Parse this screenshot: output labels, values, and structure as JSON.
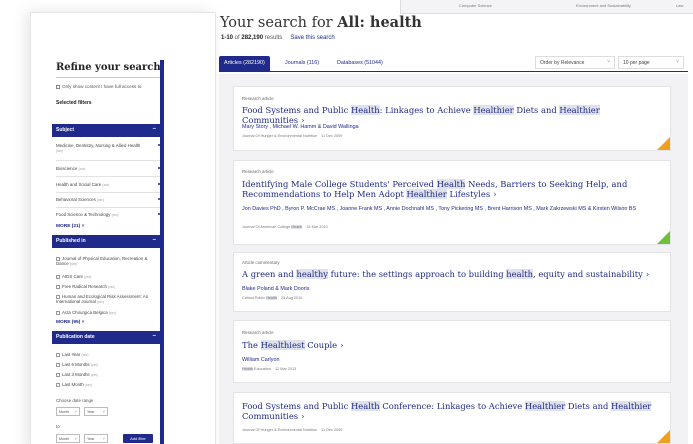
{
  "background_window": {
    "col1": "Computer Science",
    "col2": "Environment and Sustainability",
    "col3": "Law"
  },
  "search": {
    "heading_prefix": "Your search for ",
    "heading_query": "All: health",
    "range": "1-10",
    "range_of": " of ",
    "total": "282,190",
    "results_word": " results",
    "save_label": "Save this search"
  },
  "tabs": [
    {
      "label": "Articles (282190)",
      "active": true
    },
    {
      "label": "Journals (116)",
      "active": false
    },
    {
      "label": "Databases (51044)",
      "active": false
    }
  ],
  "sort": {
    "selected": "Order by Relevance"
  },
  "per_page": {
    "selected": "10 per page"
  },
  "sidebar": {
    "title": "Refine your search",
    "fulltext": "Only show content I have full access to",
    "selected_filters": "Selected filters",
    "subject": {
      "label": "Subject",
      "items": [
        {
          "label": "Medicine, Dentistry, Nursing & Allied Health",
          "count": "(xxx)"
        },
        {
          "label": "Bioscience",
          "count": "(xxx)"
        },
        {
          "label": "Health and Social Care",
          "count": "(xxx)"
        },
        {
          "label": "Behavioral Sciences",
          "count": "(xxx)"
        },
        {
          "label": "Food Science & Technology",
          "count": "(xxx)"
        }
      ],
      "more": "MORE (21) ˅"
    },
    "published_in": {
      "label": "Published in",
      "items": [
        {
          "label": "Journal of Physical Education, Recreation & Dance",
          "count": "(xxx)"
        },
        {
          "label": "AIDS Care",
          "count": "(xxx)"
        },
        {
          "label": "Free Radical Research",
          "count": "(xxx)"
        },
        {
          "label": "Human and Ecological Risk Assessment: An International Journal",
          "count": "(xxx)"
        },
        {
          "label": "Acta Chirurgica Belgica",
          "count": "(xxx)"
        }
      ],
      "more": "MORE (95) ˅"
    },
    "publication_date": {
      "label": "Publication date",
      "items": [
        {
          "label": "Last Year",
          "count": "(xxx)"
        },
        {
          "label": "Last 6 Months",
          "count": "(xxx)"
        },
        {
          "label": "Last 3 Months",
          "count": "(xxx)"
        },
        {
          "label": "Last Month",
          "count": "(xxx)"
        }
      ],
      "choose_range": "Choose date range",
      "to": "to",
      "month": "Month",
      "year": "Year",
      "add_filter": "Add filter"
    }
  },
  "results": [
    {
      "type": "Research article",
      "title_parts": [
        "Food Systems and Public ",
        "Health",
        ": Linkages to Achieve ",
        "Healthier",
        " Diets and ",
        "Healthier",
        " Communities"
      ],
      "authors": "Mary Story , Michael W. Hamm & David Wallinga",
      "meta_parts": [
        "Journal Of Hunger & Environmental Nutrition"
      ],
      "date": "11 Dec 2009",
      "access": "gold"
    },
    {
      "type": "Research article",
      "title_parts": [
        "Identifying Male College Students' Perceived ",
        "Health",
        " Needs, Barriers to Seeking Help, and Recommendations to Help Men Adopt ",
        "Healthier",
        " Lifestyles"
      ],
      "authors": "Jon Davies PhD , Byron P. McCrae MS , Joanne Frank MS , Annie Dochnahl MS , Tony Pickering MS , Brent Harrison MS , Mark Zakrzewski MS & Kirsten Wilson BS",
      "meta_parts": [
        "Journal Of American College ",
        "Health"
      ],
      "date": "24 Mar 2010",
      "access": "green"
    },
    {
      "type": "Article commentary",
      "title_parts": [
        "A green and ",
        "healthy",
        " future: the settings approach to building ",
        "health",
        ", equity and sustainability"
      ],
      "authors": "Blake Poland & Mark Dooris",
      "meta_parts": [
        "Critical Public ",
        "Health"
      ],
      "date": "25 Aug 2010",
      "access": ""
    },
    {
      "type": "Research article",
      "title_parts": [
        "The ",
        "Healthiest",
        " Couple"
      ],
      "authors": "William Carlyon",
      "meta_parts": [
        "",
        "Health",
        " Education"
      ],
      "date": "12 Mar 2013",
      "access": ""
    },
    {
      "type": "",
      "title_parts": [
        "Food Systems and Public ",
        "Health",
        " Conference: Linkages to Achieve ",
        "Healthier",
        " Diets and ",
        "Healthier",
        " Communities"
      ],
      "authors": "",
      "meta_parts": [
        "Journal Of Hunger & Environmental Nutrition"
      ],
      "date": "11 Dec 2009",
      "access": "gold"
    }
  ],
  "colors": {
    "primary": "#1f2a8a",
    "highlight": "#dfe2ea",
    "open_access": "#f0a020",
    "free_access": "#6cc03a"
  },
  "icons": {
    "dropdown": "chevron-down-icon",
    "result_arrow": "chevron-right-icon",
    "collapse": "minus-icon"
  }
}
